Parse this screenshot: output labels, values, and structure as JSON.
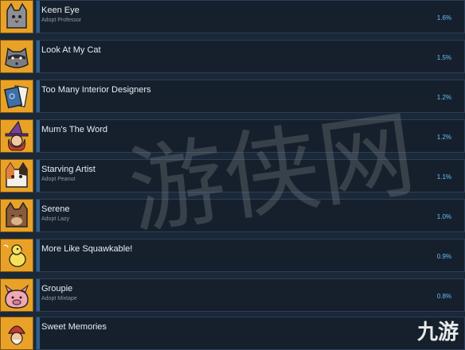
{
  "colors": {
    "background": "#1b2838",
    "panel": "#16202d",
    "progress": "#2f5f8f",
    "percent_text": "#66c0f4",
    "icon_bg": "#e9a227"
  },
  "achievements": [
    {
      "name": "Keen Eye",
      "sub": "Adopt Professor",
      "percent": "1.6%",
      "icon": "cat-gray-icon"
    },
    {
      "name": "Look At My Cat",
      "sub": "",
      "percent": "1.5%",
      "icon": "raccoon-icon"
    },
    {
      "name": "Too Many Interior Designers",
      "sub": "",
      "percent": "1.2%",
      "icon": "catalog-book-icon"
    },
    {
      "name": "Mum's The Word",
      "sub": "",
      "percent": "1.2%",
      "icon": "witch-icon"
    },
    {
      "name": "Starving Artist",
      "sub": "Adopt Peanut",
      "percent": "1.1%",
      "icon": "cat-calico-icon"
    },
    {
      "name": "Serene",
      "sub": "Adopt Lazy",
      "percent": "1.0%",
      "icon": "cat-brown-icon"
    },
    {
      "name": "More Like Squawkable!",
      "sub": "",
      "percent": "0.9%",
      "icon": "chick-icon"
    },
    {
      "name": "Groupie",
      "sub": "Adopt Mixtape",
      "percent": "0.8%",
      "icon": "pig-icon"
    },
    {
      "name": "Sweet Memories",
      "sub": "",
      "percent": "",
      "icon": "gnome-icon"
    }
  ],
  "watermark": "游侠网",
  "logo": "九游"
}
